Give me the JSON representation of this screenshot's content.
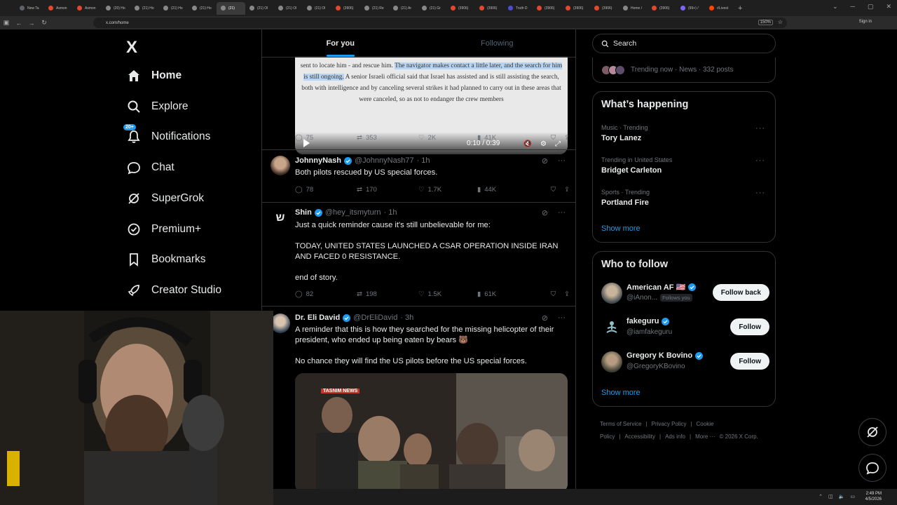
{
  "browser": {
    "tabs": [
      {
        "label": "New Ta",
        "color": "#5f6368"
      },
      {
        "label": "Asmon",
        "color": "#e0492f"
      },
      {
        "label": "Asmon",
        "color": "#e0492f"
      },
      {
        "label": "(20) Ho",
        "color": "#888888"
      },
      {
        "label": "(21) Ho",
        "color": "#888888"
      },
      {
        "label": "(21) Ho",
        "color": "#888888"
      },
      {
        "label": "(21) Ho",
        "color": "#888888"
      },
      {
        "label": "(21)",
        "color": "#888888",
        "active": true
      },
      {
        "label": "(21) Ol",
        "color": "#888888"
      },
      {
        "label": "(21) Ol",
        "color": "#888888"
      },
      {
        "label": "(21) Ol",
        "color": "#888888"
      },
      {
        "label": "(3906)",
        "color": "#e0492f"
      },
      {
        "label": "(21) Re",
        "color": "#888888"
      },
      {
        "label": "(21) Ar",
        "color": "#888888"
      },
      {
        "label": "(21) Gr",
        "color": "#888888"
      },
      {
        "label": "(3906)",
        "color": "#e0492f"
      },
      {
        "label": "(3906)",
        "color": "#e0492f"
      },
      {
        "label": "Truth D",
        "color": "#4d4dd1"
      },
      {
        "label": "(3906)",
        "color": "#e0492f"
      },
      {
        "label": "(3906)",
        "color": "#e0492f"
      },
      {
        "label": "(3906)",
        "color": "#e0492f"
      },
      {
        "label": "Home /",
        "color": "#888888"
      },
      {
        "label": "(3906)",
        "color": "#e0492f"
      },
      {
        "label": "(99+) /",
        "color": "#7b68ee"
      },
      {
        "label": "r/Livest",
        "color": "#ff4500"
      }
    ],
    "url": "x.com/home",
    "zoom": "150%",
    "signin": "Sign in"
  },
  "nav": {
    "logo": "X",
    "items": [
      {
        "label": "Home",
        "icon": "home-icon",
        "bold": true
      },
      {
        "label": "Explore",
        "icon": "search-icon"
      },
      {
        "label": "Notifications",
        "icon": "bell-icon",
        "badge": "20+"
      },
      {
        "label": "Chat",
        "icon": "chat-icon"
      },
      {
        "label": "SuperGrok",
        "icon": "grok-icon"
      },
      {
        "label": "Premium+",
        "icon": "premium-icon"
      },
      {
        "label": "Bookmarks",
        "icon": "bookmark-icon"
      },
      {
        "label": "Creator Studio",
        "icon": "rocket-icon"
      }
    ]
  },
  "feed": {
    "tabs": [
      "For you",
      "Following"
    ],
    "video": {
      "text_pre": "sent to locate him - and rescue him. ",
      "text_hl": "The navigator makes contact a little later, and the search for him is still ongoing.",
      "text_post": " A senior Israeli official said that Israel has assisted and is still assisting the search, both with intelligence and by canceling several strikes it had planned to carry out in these areas that were canceled, so as not to endanger the crew members",
      "time": "0:10 / 0:39"
    },
    "first_actions": {
      "replies": "75",
      "reposts": "353",
      "likes": "2K",
      "views": "41K"
    },
    "tweets": [
      {
        "name": "JohnnyNash",
        "handle": "@JohnnyNash77",
        "time": "· 1h",
        "text": "Both pilots rescued by US special forces.",
        "replies": "78",
        "reposts": "170",
        "likes": "1.7K",
        "views": "44K"
      },
      {
        "name": "Shin",
        "handle": "@hey_itsmyturn",
        "time": "· 1h",
        "text": "Just a quick reminder cause it's still unbelievable for me:\n\nTODAY, UNITED STATES LAUNCHED A CSAR OPERATION INSIDE IRAN AND FACED 0 RESISTANCE.\n\nend of story.",
        "replies": "82",
        "reposts": "198",
        "likes": "1.5K",
        "views": "61K"
      },
      {
        "name": "Dr. Eli David",
        "handle": "@DrEliDavid",
        "time": "· 3h",
        "text": "A reminder that this is how they searched for the missing helicopter of their president, who ended up being eaten by bears 🐻\n\nNo chance they will find the US pilots before the US special forces.",
        "photo_label": "TASNIM NEWS"
      }
    ]
  },
  "right": {
    "search_placeholder": "Search",
    "trending_now": "Trending now · News · 332 posts",
    "whats_happening": {
      "title": "What’s happening",
      "trends": [
        {
          "meta": "Music · Trending",
          "name": "Tory Lanez"
        },
        {
          "meta": "Trending in United States",
          "name": "Bridget Carleton"
        },
        {
          "meta": "Sports · Trending",
          "name": "Portland Fire"
        }
      ],
      "show_more": "Show more"
    },
    "who_to_follow": {
      "title": "Who to follow",
      "accounts": [
        {
          "name": "American AF 🇺🇸",
          "handle": "@iAnon...",
          "follows_you": "Follows you",
          "button": "Follow back"
        },
        {
          "name": "fakeguru",
          "handle": "@iamfakeguru",
          "button": "Follow"
        },
        {
          "name": "Gregory K Bovino",
          "handle": "@GregoryKBovino",
          "button": "Follow"
        }
      ],
      "show_more": "Show more"
    },
    "footer": [
      "Terms of Service",
      "|",
      "Privacy Policy",
      "|",
      "Cookie Policy",
      "|",
      "Accessibility",
      "|",
      "Ads info",
      "|",
      "More ···",
      "© 2026 X Corp."
    ]
  },
  "taskbar": {
    "time": "2:49 PM",
    "date": "4/5/2026"
  },
  "colors": {
    "accent": "#1d9bf0",
    "border": "#2f3336",
    "muted": "#71767b"
  }
}
